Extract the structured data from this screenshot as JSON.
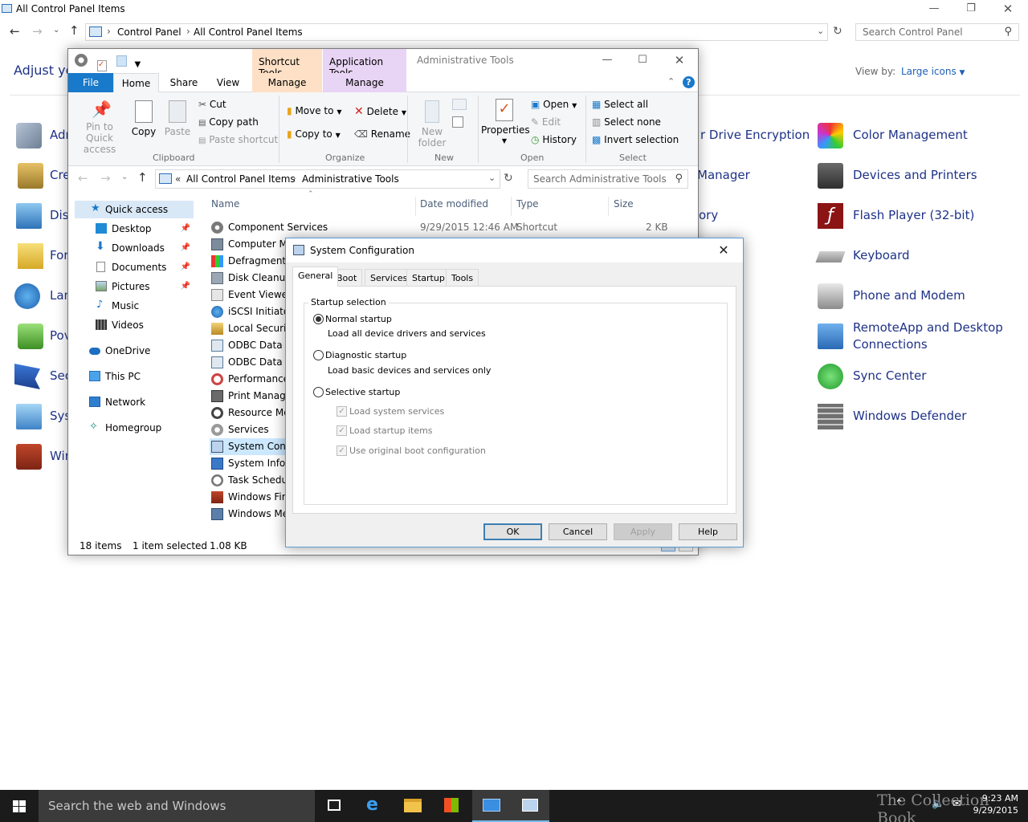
{
  "control_panel": {
    "title": "All Control Panel Items",
    "breadcrumb": [
      "Control Panel",
      "All Control Panel Items"
    ],
    "search_placeholder": "Search Control Panel",
    "heading": "Adjust yo",
    "view_by_label": "View by:",
    "view_by_value": "Large icons",
    "left_items": [
      "Adm",
      "Cre",
      "Dis",
      "For",
      "Lan",
      "Pov",
      "Sec",
      "Sys",
      "Wir"
    ],
    "mid_items": [
      "r Drive Encryption",
      "Manager",
      "ory"
    ],
    "right_items": [
      "Color Management",
      "Devices and Printers",
      "Flash Player (32-bit)",
      "Keyboard",
      "Phone and Modem",
      "RemoteApp and Desktop",
      "Connections",
      "Sync Center",
      "Windows Defender"
    ]
  },
  "explorer": {
    "contextual_tab_shortcut": "Shortcut Tools",
    "contextual_tab_app": "Application Tools",
    "window_title": "Administrative Tools",
    "tabs": [
      "File",
      "Home",
      "Share",
      "View",
      "Manage",
      "Manage"
    ],
    "ribbon": {
      "pin": "Pin to Quick",
      "pin2": "access",
      "copy": "Copy",
      "paste": "Paste",
      "cut": "Cut",
      "copy_path": "Copy path",
      "paste_shortcut": "Paste shortcut",
      "clipboard": "Clipboard",
      "move_to": "Move to",
      "copy_to": "Copy to",
      "delete": "Delete",
      "rename": "Rename",
      "organize": "Organize",
      "new_folder": "New",
      "new_folder2": "folder",
      "new": "New",
      "properties": "Properties",
      "open_btn": "Open",
      "edit": "Edit",
      "history": "History",
      "open": "Open",
      "select_all": "Select all",
      "select_none": "Select none",
      "invert_selection": "Invert selection",
      "select": "Select"
    },
    "address": [
      "«",
      "All Control Panel Items",
      "Administrative Tools"
    ],
    "search_placeholder": "Search Administrative Tools",
    "nav": {
      "quick_access": "Quick access",
      "desktop": "Desktop",
      "downloads": "Downloads",
      "documents": "Documents",
      "pictures": "Pictures",
      "music": "Music",
      "videos": "Videos",
      "onedrive": "OneDrive",
      "this_pc": "This PC",
      "network": "Network",
      "homegroup": "Homegroup"
    },
    "columns": [
      "Name",
      "Date modified",
      "Type",
      "Size"
    ],
    "files": [
      {
        "name": "Component Services",
        "date": "9/29/2015 12:46 AM",
        "type": "Shortcut",
        "size": "2 KB"
      },
      {
        "name": "Computer Ma"
      },
      {
        "name": "Defragment a"
      },
      {
        "name": "Disk Cleanup"
      },
      {
        "name": "Event Viewer"
      },
      {
        "name": "iSCSI Initiator"
      },
      {
        "name": "Local Security"
      },
      {
        "name": "ODBC Data So"
      },
      {
        "name": "ODBC Data So"
      },
      {
        "name": "Performance"
      },
      {
        "name": "Print Manage"
      },
      {
        "name": "Resource Mor"
      },
      {
        "name": "Services"
      },
      {
        "name": "System Confi"
      },
      {
        "name": "System Inform"
      },
      {
        "name": "Task Schedule"
      },
      {
        "name": "Windows Fire"
      },
      {
        "name": "Windows Mer"
      }
    ],
    "status_items": "18 items",
    "status_selected": "1 item selected",
    "status_size": "1.08 KB"
  },
  "syscfg": {
    "title": "System Configuration",
    "tabs": [
      "General",
      "Boot",
      "Services",
      "Startup",
      "Tools"
    ],
    "group_label": "Startup selection",
    "normal": "Normal startup",
    "normal_desc": "Load all device drivers and services",
    "diagnostic": "Diagnostic startup",
    "diagnostic_desc": "Load basic devices and services only",
    "selective": "Selective startup",
    "load_system_services": "Load system services",
    "load_startup_items": "Load startup items",
    "use_original_boot": "Use original boot configuration",
    "selected_option": "Normal startup",
    "buttons": {
      "ok": "OK",
      "cancel": "Cancel",
      "apply": "Apply",
      "help": "Help"
    }
  },
  "taskbar": {
    "search": "Search the web and Windows",
    "time": "9:23 AM",
    "date": "9/29/2015",
    "watermark": "The Collection Book"
  },
  "colors": {
    "accent": "#1979ca",
    "link": "#1e3287",
    "taskbar": "#1b1b1b",
    "shortcut_tools_tab": "#fde0c5",
    "application_tools_tab": "#e8d4f5"
  }
}
